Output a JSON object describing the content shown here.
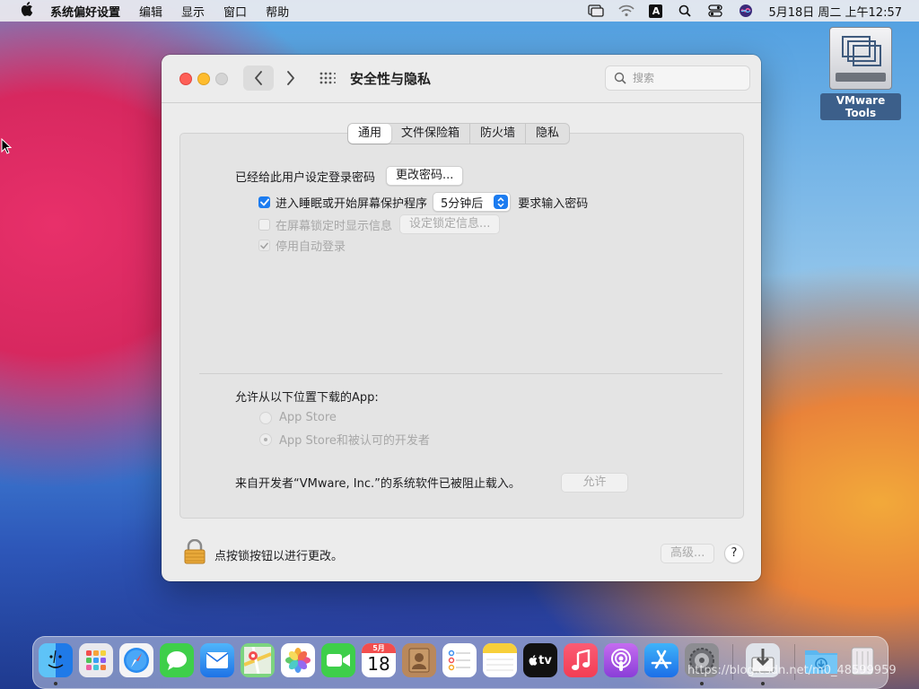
{
  "menubar": {
    "app_name": "系统偏好设置",
    "menus": [
      "编辑",
      "显示",
      "窗口",
      "帮助"
    ],
    "input_indicator": "A",
    "clock": "5月18日 周二 上午12:57"
  },
  "desktop": {
    "vmware_label": "VMware Tools"
  },
  "window": {
    "title": "安全性与隐私",
    "search_placeholder": "搜索",
    "tabs": [
      {
        "label": "通用",
        "active": true
      },
      {
        "label": "文件保险箱",
        "active": false
      },
      {
        "label": "防火墙",
        "active": false
      },
      {
        "label": "隐私",
        "active": false
      }
    ],
    "general": {
      "password_set_label": "已经给此用户设定登录密码",
      "change_password_button": "更改密码...",
      "require_password_label": "进入睡眠或开始屏幕保护程序",
      "require_password_checked": true,
      "require_password_delay": "5分钟后",
      "require_password_suffix": "要求输入密码",
      "show_message_label": "在屏幕锁定时显示信息",
      "show_message_checked": false,
      "set_lock_message_button": "设定锁定信息...",
      "disable_auto_login_label": "停用自动登录",
      "disable_auto_login_checked": true,
      "allow_apps_label": "允许从以下位置下载的App:",
      "radio_app_store": "App Store",
      "radio_app_store_dev": "App Store和被认可的开发者",
      "blocked_message": "来自开发者“VMware, Inc.”的系统软件已被阻止载入。",
      "allow_button": "允许"
    },
    "footer": {
      "lock_text": "点按锁按钮以进行更改。",
      "advanced_button": "高级...",
      "help_button": "?"
    }
  },
  "dock": {
    "calendar_month": "5月",
    "calendar_day": "18",
    "tv_label": "tv",
    "apps": [
      "finder",
      "launchpad",
      "safari",
      "messages",
      "mail",
      "maps",
      "photos",
      "facetime",
      "calendar",
      "contacts",
      "reminders",
      "notes",
      "apple-tv",
      "music",
      "podcasts",
      "app-store",
      "system-preferences",
      "downloads-installer",
      "downloads-folder",
      "trash"
    ]
  },
  "watermark": "https://blog.csdn.net/m0_48599959",
  "colors": {
    "accent": "#1c7cf0",
    "close": "#fe5f57",
    "minimize": "#febc2e"
  }
}
